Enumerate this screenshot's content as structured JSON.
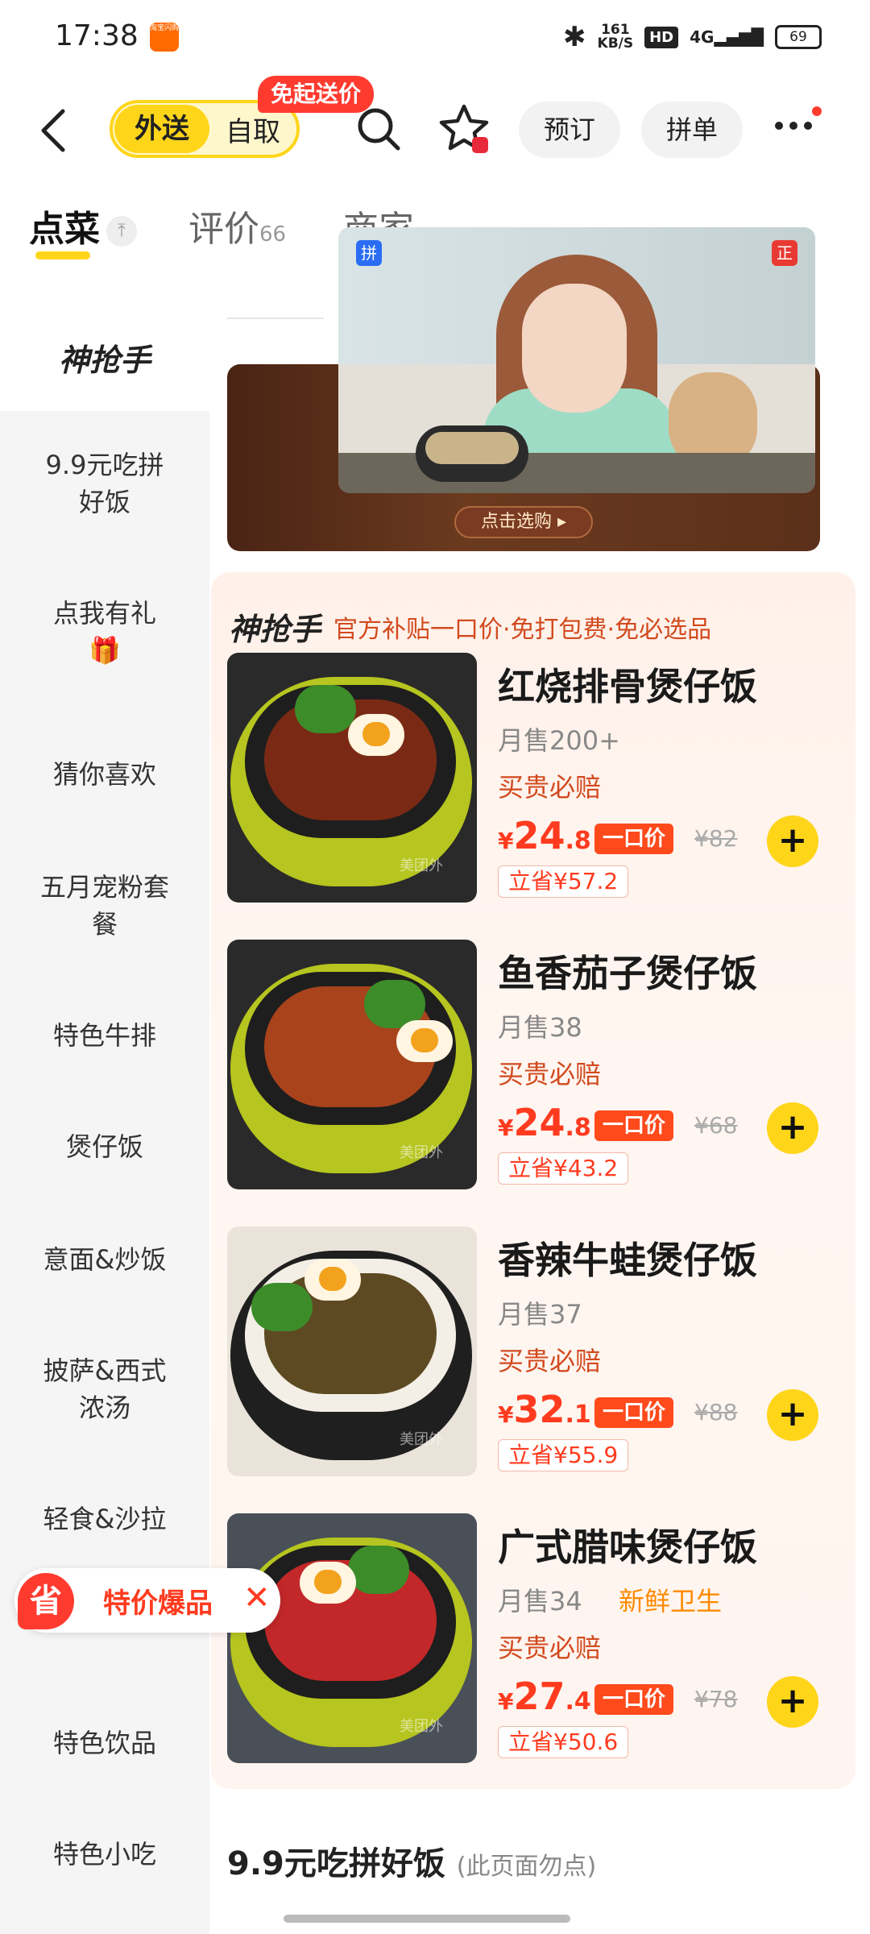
{
  "status": {
    "time": "17:38",
    "app_badge": "淘宝闪购",
    "net_speed": "161",
    "net_unit": "KB/S",
    "hd": "HD",
    "signal": "4G",
    "battery": "69"
  },
  "header": {
    "mode_delivery": "外送",
    "mode_pickup": "自取",
    "promo": "免起送价",
    "preorder": "预订",
    "group": "拼单"
  },
  "tabs": {
    "order": "点菜",
    "pin_glyph": "⤒",
    "reviews": "评价",
    "reviews_count": "66",
    "shop": "商家"
  },
  "sidebar": {
    "brand": "神抢手",
    "items": [
      "9.9元吃拼\n好饭",
      "点我有礼\n🎁",
      "猜你喜欢",
      "五月宠粉套\n餐",
      "特色牛排",
      "煲仔饭",
      "意面&炒饭",
      "披萨&西式\n浓汤",
      "轻食&沙拉",
      "特色饮品",
      "特色小吃"
    ]
  },
  "hero": {
    "button": "点击选购 ▸"
  },
  "video": {
    "tag_left": "拼",
    "tag_right": "正"
  },
  "section": {
    "brand": "神抢手",
    "subtitle": "官方补贴一口价·免打包费·免必选品"
  },
  "products": [
    {
      "name": "红烧排骨煲仔饭",
      "sales": "月售200+",
      "tag": "",
      "guarantee": "买贵必赔",
      "currency": "¥",
      "price_int": "24",
      "price_dec": ".8",
      "badge": "一口价",
      "original": "¥82",
      "save": "立省¥57.2",
      "food_color": "#7a2a14"
    },
    {
      "name": "鱼香茄子煲仔饭",
      "sales": "月售38",
      "tag": "",
      "guarantee": "买贵必赔",
      "currency": "¥",
      "price_int": "24",
      "price_dec": ".8",
      "badge": "一口价",
      "original": "¥68",
      "save": "立省¥43.2",
      "food_color": "#a8431c"
    },
    {
      "name": "香辣牛蛙煲仔饭",
      "sales": "月售37",
      "tag": "",
      "guarantee": "买贵必赔",
      "currency": "¥",
      "price_int": "32",
      "price_dec": ".1",
      "badge": "一口价",
      "original": "¥88",
      "save": "立省¥55.9",
      "food_color": "#5d4a22"
    },
    {
      "name": "广式腊味煲仔饭",
      "sales": "月售34",
      "tag": "新鲜卫生",
      "guarantee": "买贵必赔",
      "currency": "¥",
      "price_int": "27",
      "price_dec": ".4",
      "badge": "一口价",
      "original": "¥78",
      "save": "立省¥50.6",
      "food_color": "#c2282a"
    }
  ],
  "float_promo": {
    "icon": "省",
    "label": "特价爆品",
    "close": "✕"
  },
  "bottom": {
    "title": "9.9元吃拼好饭",
    "note": "(此页面勿点)"
  },
  "colors": {
    "accent_yellow": "#ffd51a",
    "price_red": "#ff3b1f",
    "promo_red": "#ff3b30"
  },
  "icons": {
    "back": "back-arrow-icon",
    "search": "search-icon",
    "favorite": "star-icon",
    "more": "more-dots-icon",
    "add": "plus-icon"
  }
}
